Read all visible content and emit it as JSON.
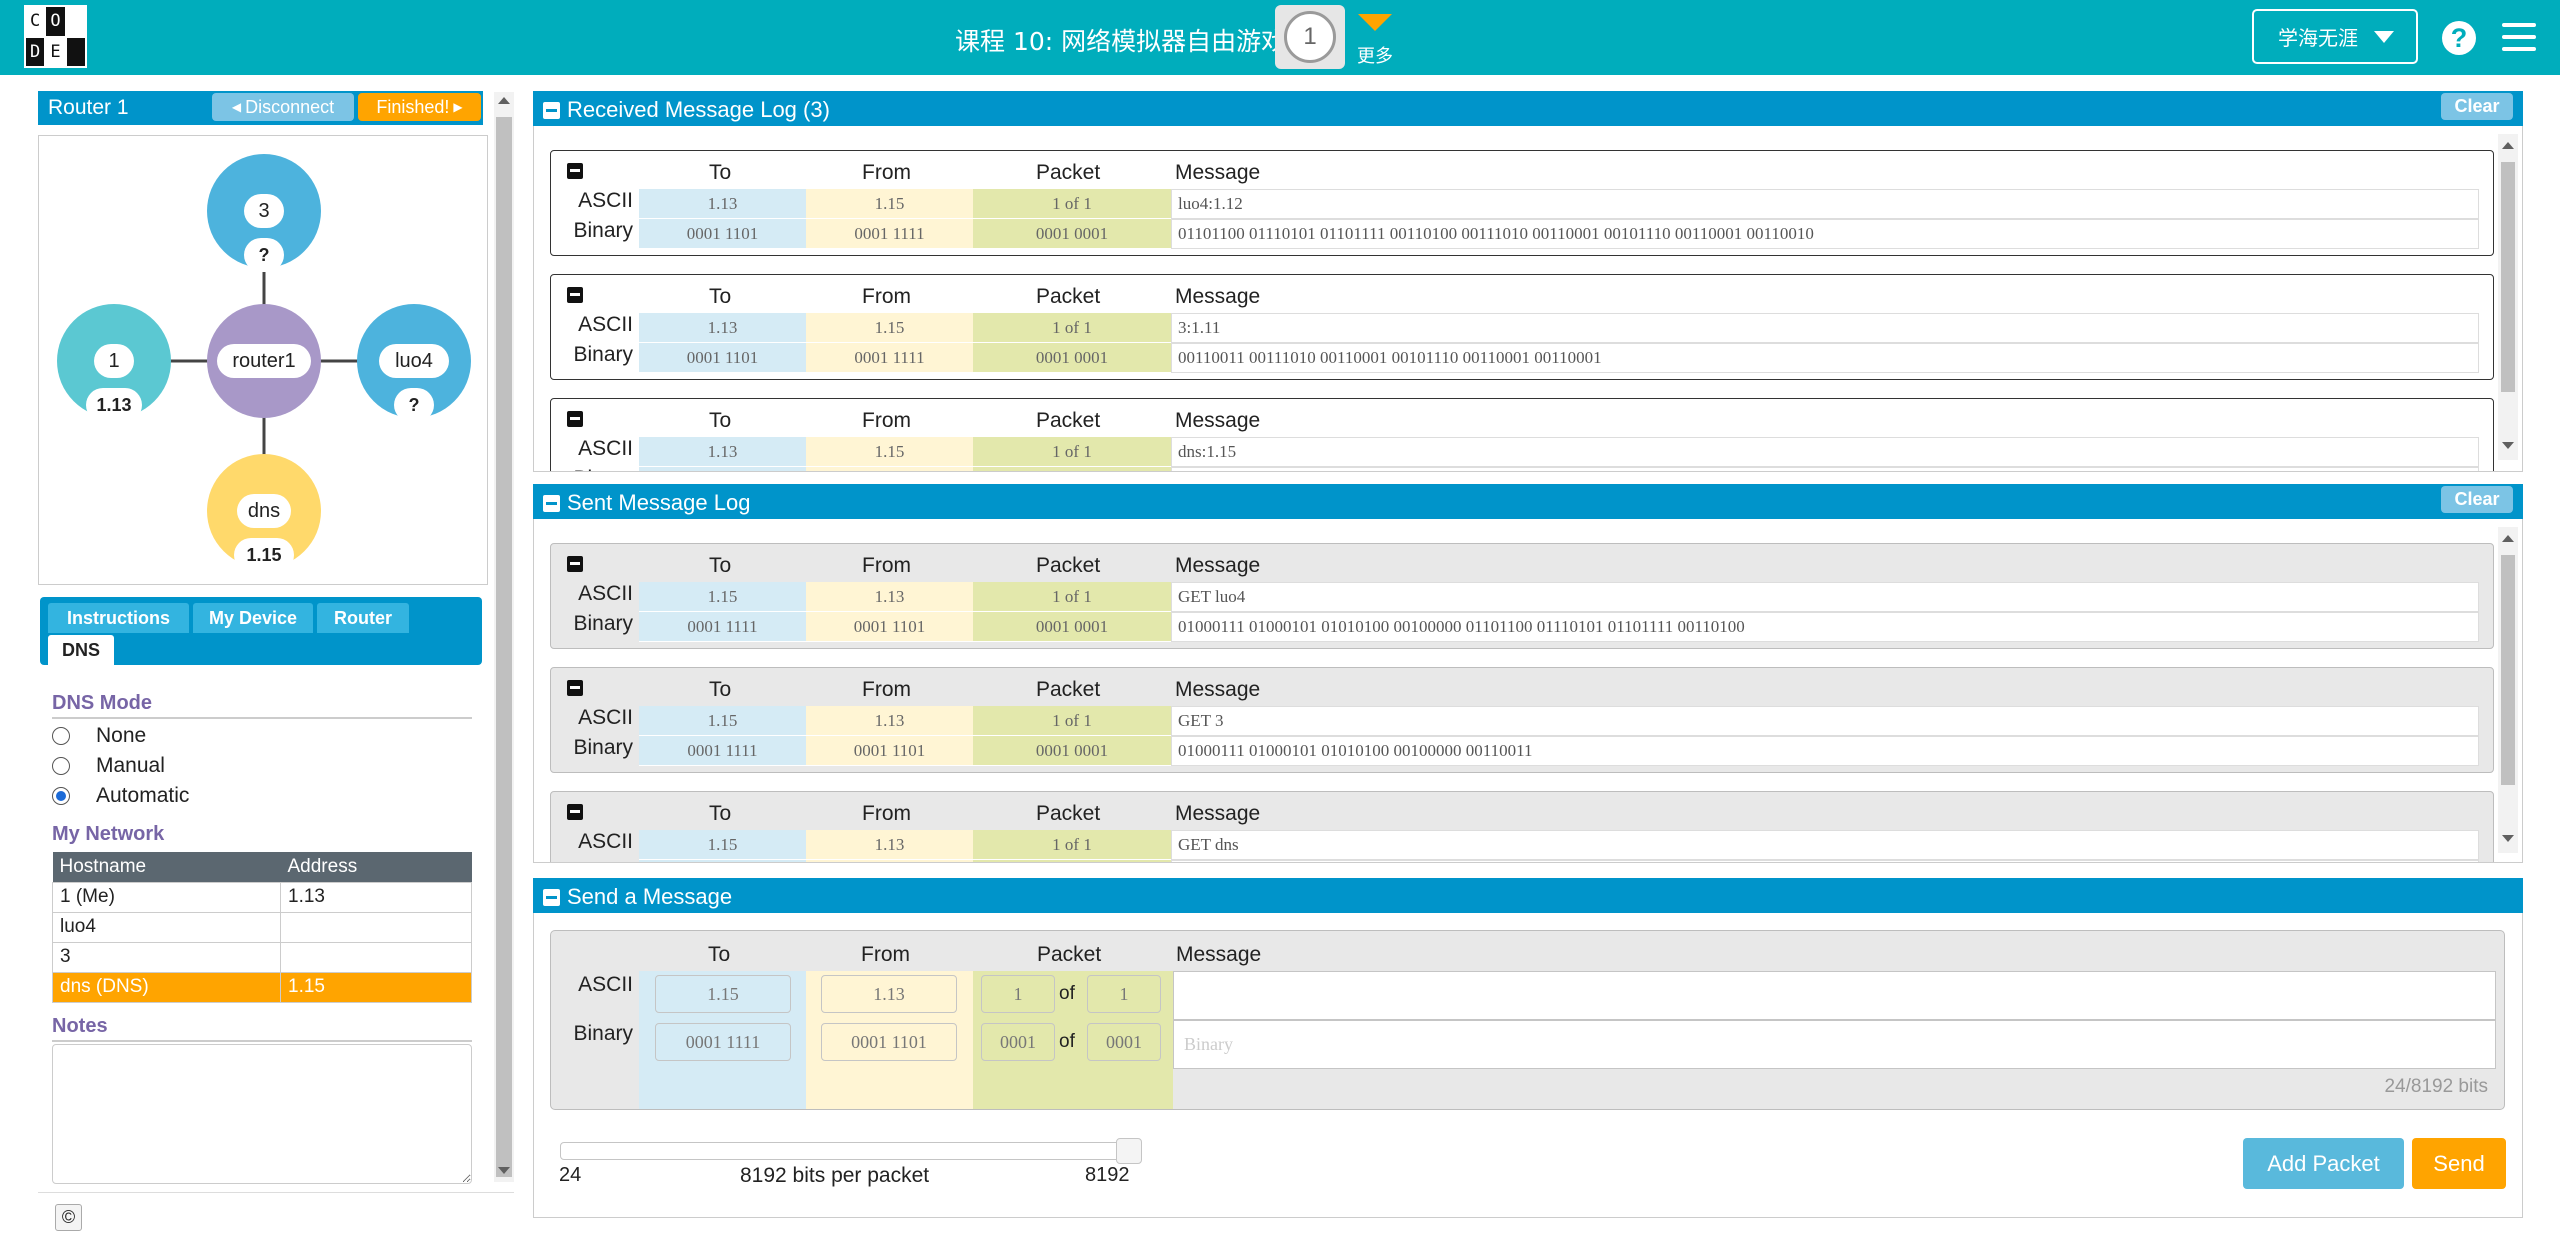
{
  "header": {
    "logo_letters": [
      "C",
      "O",
      "D",
      "E"
    ],
    "lesson_title": "课程 10: 网络模拟器自由游戏",
    "level_number": "1",
    "more_label": "更多",
    "user_name": "学海无涯",
    "help_glyph": "?",
    "color": "#00adbc"
  },
  "router_panel": {
    "title": "Router 1",
    "disconnect_label": "Disconnect",
    "finished_label": "Finished!"
  },
  "graph": {
    "router_label": "router1",
    "nodes": [
      {
        "name": "3",
        "address": "?",
        "color": "#4db3dd"
      },
      {
        "name": "1",
        "address": "1.13",
        "color": "#5bc8d2"
      },
      {
        "name": "luo4",
        "address": "?",
        "color": "#4db3dd"
      },
      {
        "name": "dns",
        "address": "1.15",
        "color": "#ffd96b"
      }
    ],
    "router_color": "#a898c8"
  },
  "tabs": [
    "Instructions",
    "My Device",
    "Router",
    "DNS"
  ],
  "active_tab": "DNS",
  "dns_mode": {
    "heading": "DNS Mode",
    "options": [
      "None",
      "Manual",
      "Automatic"
    ],
    "selected": "Automatic"
  },
  "my_network": {
    "heading": "My Network",
    "columns": [
      "Hostname",
      "Address"
    ],
    "rows": [
      [
        "1 (Me)",
        "1.13"
      ],
      [
        "luo4",
        ""
      ],
      [
        "3",
        ""
      ],
      [
        "dns (DNS)",
        "1.15"
      ]
    ]
  },
  "notes": {
    "heading": "Notes"
  },
  "copyright_glyph": "©",
  "received_log": {
    "title": "Received Message Log (3)",
    "clear_label": "Clear",
    "columns": [
      "To",
      "From",
      "Packet",
      "Message"
    ],
    "row_labels": [
      "ASCII",
      "Binary"
    ],
    "packets": [
      {
        "to_ascii": "1.13",
        "from_ascii": "1.15",
        "packet_ascii": "1 of 1",
        "message_ascii": "luo4:1.12",
        "to_bin": "0001 1101",
        "from_bin": "0001 1111",
        "packet_bin": "0001 0001",
        "message_bin": "01101100 01110101 01101111 00110100 00111010 00110001 00101110 00110001 00110010"
      },
      {
        "to_ascii": "1.13",
        "from_ascii": "1.15",
        "packet_ascii": "1 of 1",
        "message_ascii": "3:1.11",
        "to_bin": "0001 1101",
        "from_bin": "0001 1111",
        "packet_bin": "0001 0001",
        "message_bin": "00110011 00111010 00110001 00101110 00110001 00110001"
      },
      {
        "to_ascii": "1.13",
        "from_ascii": "1.15",
        "packet_ascii": "1 of 1",
        "message_ascii": "dns:1.15",
        "to_bin": "",
        "from_bin": "",
        "packet_bin": "",
        "message_bin": ""
      }
    ]
  },
  "sent_log": {
    "title": "Sent Message Log",
    "clear_label": "Clear",
    "columns": [
      "To",
      "From",
      "Packet",
      "Message"
    ],
    "row_labels": [
      "ASCII",
      "Binary"
    ],
    "packets": [
      {
        "to_ascii": "1.15",
        "from_ascii": "1.13",
        "packet_ascii": "1 of 1",
        "message_ascii": "GET luo4",
        "to_bin": "0001 1111",
        "from_bin": "0001 1101",
        "packet_bin": "0001 0001",
        "message_bin": "01000111 01000101 01010100 00100000 01101100 01110101 01101111 00110100"
      },
      {
        "to_ascii": "1.15",
        "from_ascii": "1.13",
        "packet_ascii": "1 of 1",
        "message_ascii": "GET 3",
        "to_bin": "0001 1111",
        "from_bin": "0001 1101",
        "packet_bin": "0001 0001",
        "message_bin": "01000111 01000101 01010100 00100000 00110011"
      },
      {
        "to_ascii": "1.15",
        "from_ascii": "1.13",
        "packet_ascii": "1 of 1",
        "message_ascii": "GET dns",
        "to_bin": "",
        "from_bin": "",
        "packet_bin": "",
        "message_bin": ""
      }
    ]
  },
  "send_message": {
    "title": "Send a Message",
    "columns": [
      "To",
      "From",
      "Packet",
      "Message"
    ],
    "row_labels": [
      "ASCII",
      "Binary"
    ],
    "to_ascii": "1.15",
    "from_ascii": "1.13",
    "packet_num_ascii": "1",
    "packet_total_ascii": "1",
    "of_label": "of",
    "to_bin": "0001 1111",
    "from_bin": "0001 1101",
    "packet_num_bin": "0001",
    "packet_total_bin": "0001",
    "message_ascii": "",
    "message_bin_placeholder": "Binary",
    "bit_counter": "24/8192 bits",
    "slider_min": "24",
    "slider_max": "8192",
    "slider_caption": "8192 bits per packet",
    "slider_value": 8192,
    "add_packet_label": "Add Packet",
    "send_label": "Send"
  }
}
